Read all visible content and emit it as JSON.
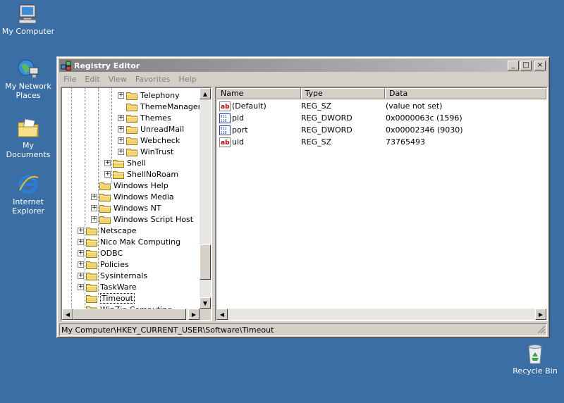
{
  "desktop": {
    "icons": [
      {
        "label": "My Computer",
        "icon": "my-computer-icon"
      },
      {
        "label": "My Network Places",
        "icon": "network-places-icon"
      },
      {
        "label": "My Documents",
        "icon": "my-documents-icon"
      },
      {
        "label": "Internet Explorer",
        "icon": "internet-explorer-icon"
      },
      {
        "label": "Recycle Bin",
        "icon": "recycle-bin-icon"
      }
    ]
  },
  "window": {
    "title": "Registry Editor",
    "minimize": "_",
    "maximize": "□",
    "close": "×",
    "menu": [
      "File",
      "Edit",
      "View",
      "Favorites",
      "Help"
    ],
    "status": "My Computer\\HKEY_CURRENT_USER\\Software\\Timeout"
  },
  "tree": {
    "items": [
      {
        "label": "Telephony",
        "expander": "+"
      },
      {
        "label": "ThemeManager",
        "expander": ""
      },
      {
        "label": "Themes",
        "expander": "+"
      },
      {
        "label": "UnreadMail",
        "expander": "+"
      },
      {
        "label": "Webcheck",
        "expander": "+"
      },
      {
        "label": "WinTrust",
        "expander": "+"
      },
      {
        "label": "Shell",
        "expander": "+"
      },
      {
        "label": "ShellNoRoam",
        "expander": "+"
      },
      {
        "label": "Windows Help",
        "expander": ""
      },
      {
        "label": "Windows Media",
        "expander": "+"
      },
      {
        "label": "Windows NT",
        "expander": "+"
      },
      {
        "label": "Windows Script Host",
        "expander": "+"
      },
      {
        "label": "Netscape",
        "expander": "+"
      },
      {
        "label": "Nico Mak Computing",
        "expander": "+"
      },
      {
        "label": "ODBC",
        "expander": "+"
      },
      {
        "label": "Policies",
        "expander": "+"
      },
      {
        "label": "Sysinternals",
        "expander": "+"
      },
      {
        "label": "TaskWare",
        "expander": "+"
      },
      {
        "label": "Timeout",
        "expander": "",
        "selected": true
      },
      {
        "label": "WinZip Computing",
        "expander": ""
      }
    ]
  },
  "list": {
    "columns": [
      "Name",
      "Type",
      "Data"
    ],
    "rows": [
      {
        "name": "(Default)",
        "type": "REG_SZ",
        "data": "(value not set)",
        "icon": "string-value-icon"
      },
      {
        "name": "pid",
        "type": "REG_DWORD",
        "data": "0x0000063c (1596)",
        "icon": "dword-value-icon"
      },
      {
        "name": "port",
        "type": "REG_DWORD",
        "data": "0x00002346 (9030)",
        "icon": "dword-value-icon"
      },
      {
        "name": "uid",
        "type": "REG_SZ",
        "data": "73765493",
        "icon": "string-value-icon"
      }
    ]
  },
  "colors": {
    "desktop": "#3a6ea5",
    "window_face": "#d4d0c8",
    "folder": "#f5d36b"
  }
}
